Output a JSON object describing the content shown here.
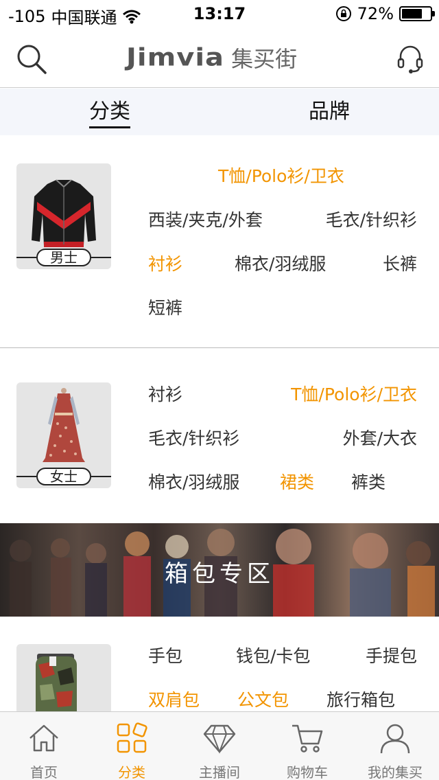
{
  "status_bar": {
    "signal": "-105",
    "carrier": "中国联通",
    "time": "13:17",
    "battery": "72%",
    "battery_level": 0.72
  },
  "header": {
    "logo_en": "Jimvia",
    "logo_zh": "集买街"
  },
  "tabs": [
    {
      "label": "分类",
      "active": true
    },
    {
      "label": "品牌",
      "active": false
    }
  ],
  "sections": {
    "men": {
      "label": "男士",
      "links": [
        {
          "text": "T恤/Polo衫/卫衣",
          "highlight": true
        },
        {
          "text": "西装/夹克/外套",
          "highlight": false
        },
        {
          "text": "毛衣/针织衫",
          "highlight": false
        },
        {
          "text": "衬衫",
          "highlight": true
        },
        {
          "text": "棉衣/羽绒服",
          "highlight": false
        },
        {
          "text": "长裤",
          "highlight": false
        },
        {
          "text": "短裤",
          "highlight": false
        }
      ]
    },
    "women": {
      "label": "女士",
      "links": [
        {
          "text": "衬衫",
          "highlight": false
        },
        {
          "text": "T恤/Polo衫/卫衣",
          "highlight": true
        },
        {
          "text": "毛衣/针织衫",
          "highlight": false
        },
        {
          "text": "外套/大衣",
          "highlight": false
        },
        {
          "text": "棉衣/羽绒服",
          "highlight": false
        },
        {
          "text": "裙类",
          "highlight": true
        },
        {
          "text": "裤类",
          "highlight": false
        }
      ]
    },
    "bags": {
      "links": [
        {
          "text": "手包",
          "highlight": false
        },
        {
          "text": "钱包/卡包",
          "highlight": false
        },
        {
          "text": "手提包",
          "highlight": false
        },
        {
          "text": "双肩包",
          "highlight": true
        },
        {
          "text": "公文包",
          "highlight": true
        },
        {
          "text": "旅行箱包",
          "highlight": false
        }
      ]
    }
  },
  "banner": {
    "title": "箱包专区"
  },
  "tabbar": [
    {
      "label": "首页",
      "icon": "home-icon",
      "active": false
    },
    {
      "label": "分类",
      "icon": "category-grid-icon",
      "active": true
    },
    {
      "label": "主播间",
      "icon": "diamond-icon",
      "active": false
    },
    {
      "label": "购物车",
      "icon": "cart-icon",
      "active": false
    },
    {
      "label": "我的集买",
      "icon": "user-icon",
      "active": false
    }
  ],
  "colors": {
    "accent": "#f29400",
    "text": "#333333",
    "tab_bg": "#f4f6fb"
  }
}
